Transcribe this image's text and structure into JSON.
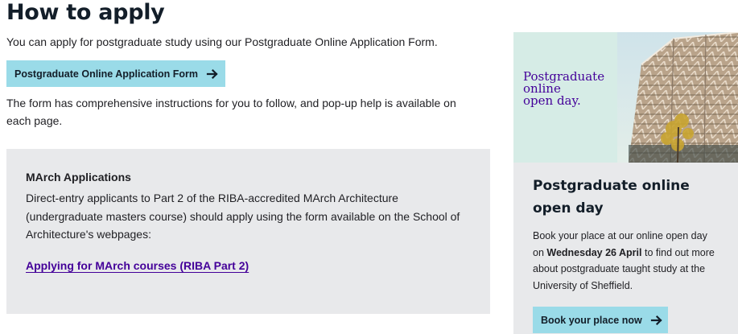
{
  "page": {
    "title": "How to apply",
    "intro": "You can apply for postgraduate study using our Postgraduate Online Application Form.",
    "application_button_label": "Postgraduate Online Application Form",
    "instructions": "The form has comprehensive instructions for you to follow, and pop-up help is available on each page."
  },
  "march": {
    "heading": "MArch Applications",
    "text": "Direct-entry applicants to Part 2 of the RIBA-accredited MArch Architecture (undergraduate masters course) should apply using the form available on the School of Architecture's webpages:",
    "link_label": "Applying for MArch courses (RIBA Part 2)"
  },
  "promo": {
    "image_text": [
      "Postgraduate",
      "online",
      "open day."
    ],
    "title": "Postgraduate online open day",
    "text_before": "Book your place at our online open day on ",
    "text_bold": "Wednesday 26 April",
    "text_after": " to find out more about postgraduate taught study at the University of Sheffield.",
    "button_label": "Book your place now"
  },
  "colors": {
    "accent_button": "#9ADBE8",
    "link_purple": "#440099",
    "panel_grey": "#E8E9EB",
    "promo_image_bg": "#D6ECE6"
  },
  "icons": {
    "cta_arrow": "arrow-right-icon",
    "promo_arrow": "arrow-right-icon"
  }
}
